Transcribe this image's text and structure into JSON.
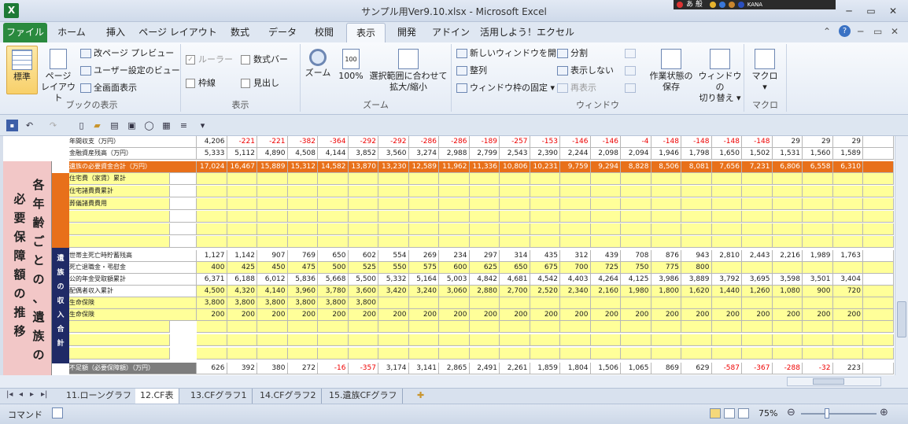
{
  "window": {
    "title": "サンプル用Ver9.10.xlsx - Microsoft Excel",
    "tray_text": "あ 般",
    "tray_kana": "KANA"
  },
  "tabs": [
    "ファイル",
    "ホーム",
    "挿入",
    "ページ レイアウト",
    "数式",
    "データ",
    "校閲",
    "表示",
    "開発",
    "アドイン",
    "活用しよう！エクセル"
  ],
  "ribbon": {
    "book_view": {
      "label": "ブックの表示",
      "normal": "標準",
      "page_layout_1": "ページ",
      "page_layout_2": "レイアウト",
      "page_break": "改ページ プレビュー",
      "custom": "ユーザー設定のビュー",
      "full": "全画面表示"
    },
    "show": {
      "label": "表示",
      "ruler": "ルーラー",
      "formula_bar": "数式バー",
      "gridlines": "枠線",
      "headings": "見出し"
    },
    "zoom": {
      "label": "ズーム",
      "zoom": "ズーム",
      "hundred": "100%",
      "fit_1": "選択範囲に合わせて",
      "fit_2": "拡大/縮小"
    },
    "window": {
      "label": "ウィンドウ",
      "new_window": "新しいウィンドウを開く",
      "arrange": "整列",
      "freeze": "ウィンドウ枠の固定",
      "split": "分割",
      "hide": "表示しない",
      "unhide": "再表示",
      "save_ws_1": "作業状態の",
      "save_ws_2": "保存",
      "switch_1": "ウィンドウの",
      "switch_2": "切り替え"
    },
    "macro": {
      "label": "マクロ",
      "macro": "マクロ"
    }
  },
  "sheet": {
    "row_annual": {
      "label": "年間収支（万円）",
      "values": [
        "4,206",
        "-221",
        "-221",
        "-382",
        "-364",
        "-292",
        "-292",
        "-286",
        "-286",
        "-189",
        "-257",
        "-153",
        "-146",
        "-146",
        "-4",
        "-148",
        "-148",
        "-148",
        "-148",
        "29",
        "29",
        "29"
      ]
    },
    "row_fin": {
      "label": "金融資産残高（万円）",
      "values": [
        "5,333",
        "5,112",
        "4,890",
        "4,508",
        "4,144",
        "3,852",
        "3,560",
        "3,274",
        "2,988",
        "2,799",
        "2,543",
        "2,390",
        "2,244",
        "2,098",
        "2,094",
        "1,946",
        "1,798",
        "1,650",
        "1,502",
        "1,531",
        "1,560",
        "1,589"
      ]
    },
    "row_need": {
      "label": "遺族の必要資金合計（万円）",
      "values": [
        "17,024",
        "16,467",
        "15,889",
        "15,312",
        "14,582",
        "13,870",
        "13,230",
        "12,589",
        "11,962",
        "11,336",
        "10,806",
        "10,231",
        "9,759",
        "9,294",
        "8,828",
        "8,506",
        "8,081",
        "7,656",
        "7,231",
        "6,806",
        "6,558",
        "6,310"
      ]
    },
    "need_rows": [
      "住宅費（家賃）累計",
      "住宅諸費費累計",
      "葬儀諸費費用",
      "",
      "",
      ""
    ],
    "row_spouse": {
      "label": "世帯主死亡時貯蓄残高",
      "values": [
        "1,127",
        "1,142",
        "907",
        "769",
        "650",
        "602",
        "554",
        "269",
        "234",
        "297",
        "314",
        "435",
        "312",
        "439",
        "708",
        "876",
        "943",
        "2,810",
        "2,443",
        "2,216",
        "1,989",
        "1,763"
      ]
    },
    "row_retire": {
      "label": "死亡退職金・弔慰金",
      "values": [
        "400",
        "425",
        "450",
        "475",
        "500",
        "525",
        "550",
        "575",
        "600",
        "625",
        "650",
        "675",
        "700",
        "725",
        "750",
        "775",
        "800"
      ]
    },
    "row_pension": {
      "label": "公的年金受取額累計",
      "values": [
        "6,371",
        "6,188",
        "6,012",
        "5,836",
        "5,668",
        "5,500",
        "5,332",
        "5,164",
        "5,003",
        "4,842",
        "4,681",
        "4,542",
        "4,403",
        "4,264",
        "4,125",
        "3,986",
        "3,889",
        "3,792",
        "3,695",
        "3,598",
        "3,501",
        "3,404"
      ]
    },
    "row_spouse_income": {
      "label": "配偶者収入累計",
      "values": [
        "4,500",
        "4,320",
        "4,140",
        "3,960",
        "3,780",
        "3,600",
        "3,420",
        "3,240",
        "3,060",
        "2,880",
        "2,700",
        "2,520",
        "2,340",
        "2,160",
        "1,980",
        "1,800",
        "1,620",
        "1,440",
        "1,260",
        "1,080",
        "900",
        "720"
      ]
    },
    "row_life1": {
      "label": "生命保険",
      "values": [
        "3,800",
        "3,800",
        "3,800",
        "3,800",
        "3,800",
        "3,800"
      ]
    },
    "row_life2": {
      "label": "生命保険",
      "values": [
        "200",
        "200",
        "200",
        "200",
        "200",
        "200",
        "200",
        "200",
        "200",
        "200",
        "200",
        "200",
        "200",
        "200",
        "200",
        "200",
        "200",
        "200",
        "200",
        "200",
        "200",
        "200"
      ]
    },
    "row_short": {
      "label": "不足額（必要保障額）（万円）",
      "values": [
        "626",
        "392",
        "380",
        "272",
        "-16",
        "-357",
        "3,174",
        "3,141",
        "2,865",
        "2,491",
        "2,261",
        "1,859",
        "1,804",
        "1,506",
        "1,065",
        "869",
        "629",
        "-587",
        "-367",
        "-288",
        "-32",
        "223"
      ]
    },
    "side_pink": [
      "各",
      "年",
      "齢",
      "ご",
      "と",
      "の",
      "必",
      "要",
      "保",
      "障",
      "額",
      "の",
      "推",
      "移",
      "、",
      "遺",
      "族",
      "の"
    ],
    "side_navy": [
      "遺",
      "族",
      "の",
      "収",
      "入",
      "合",
      "計"
    ]
  },
  "sheet_tabs": [
    "11.ローングラフ",
    "12.CF表",
    "13.CFグラフ1",
    "14.CFグラフ2",
    "15.遺族CFグラフ"
  ],
  "status": {
    "mode": "コマンド",
    "zoom": "75%"
  }
}
